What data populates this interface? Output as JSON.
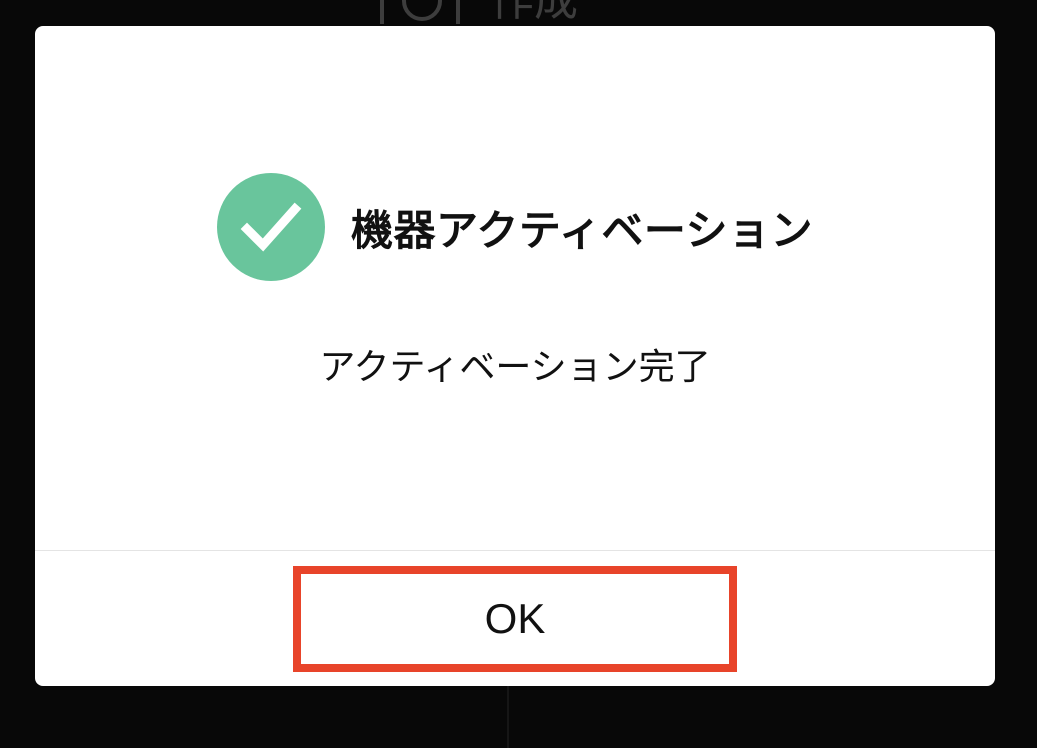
{
  "background": {
    "title_text": "作成"
  },
  "dialog": {
    "title": "機器アクティベーション",
    "message": "アクティベーション完了",
    "ok_label": "OK",
    "icon": "check-circle-icon",
    "colors": {
      "success": "#69c59c",
      "highlight": "#e8442a",
      "overlay": "#000000"
    }
  }
}
